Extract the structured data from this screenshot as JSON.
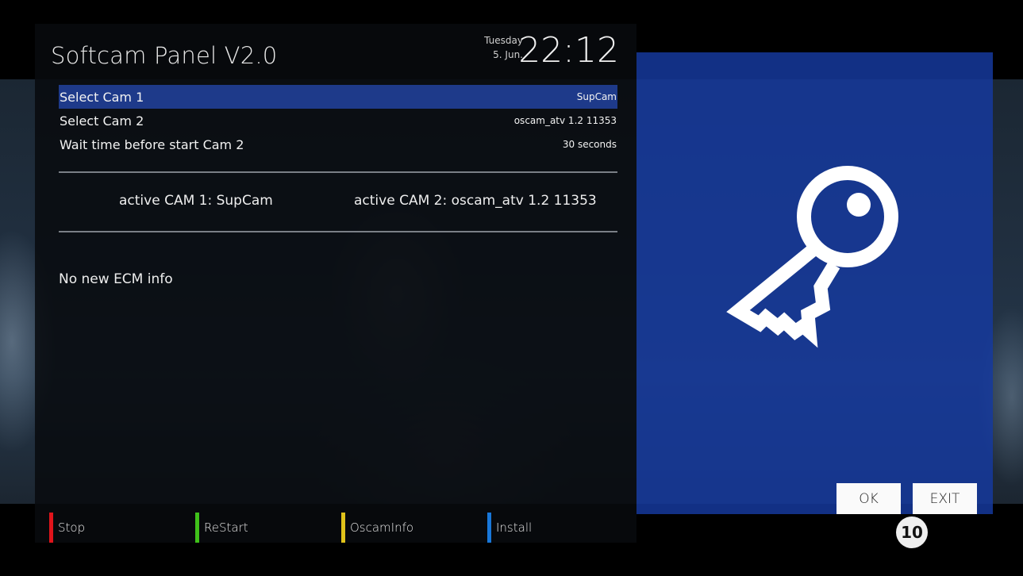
{
  "panel": {
    "title": "Softcam Panel V2.0",
    "clock": {
      "day": "Tuesday",
      "date": "5. Jun.",
      "time": "22:12"
    }
  },
  "menu": [
    {
      "label": "Select Cam 1",
      "value": "SupCam",
      "selected": true
    },
    {
      "label": "Select Cam 2",
      "value": "oscam_atv 1.2 11353",
      "selected": false
    },
    {
      "label": "Wait time before start Cam 2",
      "value": "30 seconds",
      "selected": false
    }
  ],
  "status": {
    "active_cam1": "active CAM 1: SupCam",
    "active_cam2": "active CAM 2: oscam_atv 1.2 11353",
    "ecm_info": "No new ECM info"
  },
  "footer": {
    "keys": [
      {
        "label": "Stop",
        "color": "#e0141b",
        "icon": "red-key-icon"
      },
      {
        "label": "ReStart",
        "color": "#3fc01a",
        "icon": "green-key-icon"
      },
      {
        "label": "OscamInfo",
        "color": "#e0c21a",
        "icon": "yellow-key-icon"
      },
      {
        "label": "Install",
        "color": "#1877d9",
        "icon": "blue-key-icon"
      }
    ]
  },
  "side_panel": {
    "icon": "key-icon",
    "accent": "#15399e",
    "ok_label": "OK",
    "exit_label": "EXIT",
    "badge": "10"
  }
}
